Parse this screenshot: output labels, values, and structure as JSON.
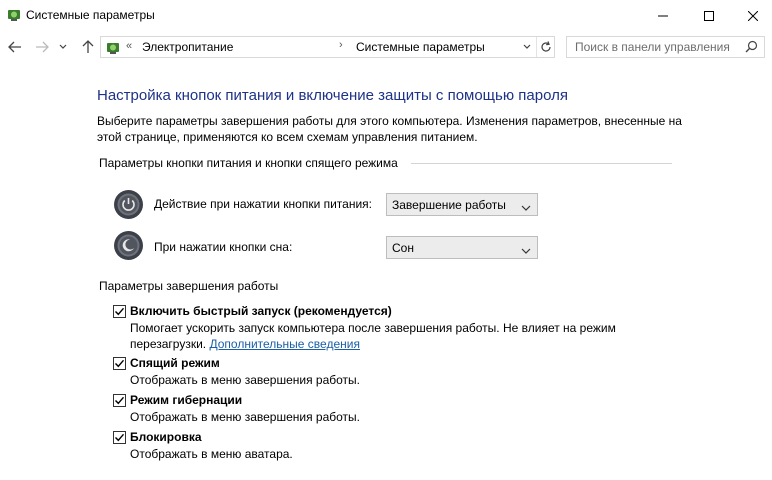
{
  "window": {
    "title": "Системные параметры"
  },
  "nav": {
    "breadcrumb_prefix": "«",
    "breadcrumb": [
      "Электропитание",
      "Системные параметры"
    ],
    "search_placeholder": "Поиск в панели управления"
  },
  "main": {
    "title": "Настройка кнопок питания и включение защиты с помощью пароля",
    "description": "Выберите параметры завершения работы для этого компьютера. Изменения параметров, внесенные на этой странице, применяются ко всем схемам управления питанием.",
    "power_section": {
      "header": "Параметры кнопки питания и кнопки спящего режима",
      "rows": [
        {
          "label": "Действие при нажатии кнопки питания:",
          "value": "Завершение работы",
          "icon": "power-button-icon"
        },
        {
          "label": "При нажатии кнопки сна:",
          "value": "Сон",
          "icon": "sleep-button-icon"
        }
      ]
    },
    "shutdown_section": {
      "header": "Параметры завершения работы",
      "options": [
        {
          "label": "Включить быстрый запуск (рекомендуется)",
          "checked": true,
          "desc_line1": "Помогает ускорить запуск компьютера после завершения работы. Не влияет на режим",
          "desc_line2": "перезагрузки.",
          "link": "Дополнительные сведения"
        },
        {
          "label": "Спящий режим",
          "checked": true,
          "desc": "Отображать в меню завершения работы."
        },
        {
          "label": "Режим гибернации",
          "checked": true,
          "desc": "Отображать в меню завершения работы."
        },
        {
          "label": "Блокировка",
          "checked": true,
          "desc": "Отображать в меню аватара."
        }
      ]
    }
  }
}
